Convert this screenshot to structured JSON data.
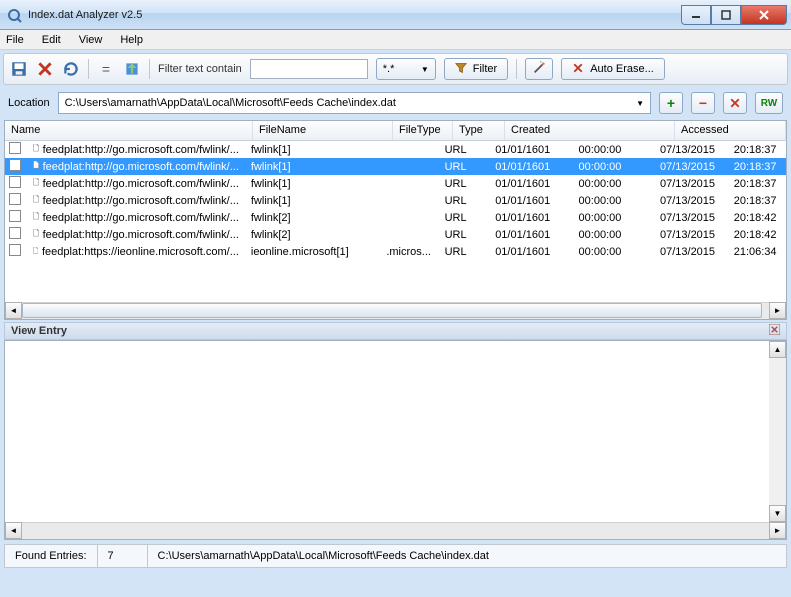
{
  "window": {
    "title": "Index.dat Analyzer v2.5"
  },
  "menu": {
    "file": "File",
    "edit": "Edit",
    "view": "View",
    "help": "Help"
  },
  "toolbar": {
    "filter_label": "Filter text contain",
    "filter_value": "",
    "wildcard": "*.*",
    "filter_btn": "Filter",
    "auto_erase": "Auto Erase..."
  },
  "location": {
    "label": "Location",
    "path": "C:\\Users\\amarnath\\AppData\\Local\\Microsoft\\Feeds Cache\\index.dat",
    "rw": "RW"
  },
  "columns": {
    "name": "Name",
    "filename": "FileName",
    "filetype": "FileType",
    "type": "Type",
    "created": "Created",
    "accessed": "Accessed"
  },
  "rows": [
    {
      "name": "feedplat:http://go.microsoft.com/fwlink/...",
      "filename": "fwlink[1]",
      "filetype": "",
      "type": "URL",
      "created_d": "01/01/1601",
      "created_t": "00:00:00",
      "accessed_d": "07/13/2015",
      "accessed_t": "20:18:37",
      "selected": false
    },
    {
      "name": "feedplat:http://go.microsoft.com/fwlink/...",
      "filename": "fwlink[1]",
      "filetype": "",
      "type": "URL",
      "created_d": "01/01/1601",
      "created_t": "00:00:00",
      "accessed_d": "07/13/2015",
      "accessed_t": "20:18:37",
      "selected": true
    },
    {
      "name": "feedplat:http://go.microsoft.com/fwlink/...",
      "filename": "fwlink[1]",
      "filetype": "",
      "type": "URL",
      "created_d": "01/01/1601",
      "created_t": "00:00:00",
      "accessed_d": "07/13/2015",
      "accessed_t": "20:18:37",
      "selected": false
    },
    {
      "name": "feedplat:http://go.microsoft.com/fwlink/...",
      "filename": "fwlink[1]",
      "filetype": "",
      "type": "URL",
      "created_d": "01/01/1601",
      "created_t": "00:00:00",
      "accessed_d": "07/13/2015",
      "accessed_t": "20:18:37",
      "selected": false
    },
    {
      "name": "feedplat:http://go.microsoft.com/fwlink/...",
      "filename": "fwlink[2]",
      "filetype": "",
      "type": "URL",
      "created_d": "01/01/1601",
      "created_t": "00:00:00",
      "accessed_d": "07/13/2015",
      "accessed_t": "20:18:42",
      "selected": false
    },
    {
      "name": "feedplat:http://go.microsoft.com/fwlink/...",
      "filename": "fwlink[2]",
      "filetype": "",
      "type": "URL",
      "created_d": "01/01/1601",
      "created_t": "00:00:00",
      "accessed_d": "07/13/2015",
      "accessed_t": "20:18:42",
      "selected": false
    },
    {
      "name": "feedplat:https://ieonline.microsoft.com/...",
      "filename": "ieonline.microsoft[1]",
      "filetype": ".micros...",
      "type": "URL",
      "created_d": "01/01/1601",
      "created_t": "00:00:00",
      "accessed_d": "07/13/2015",
      "accessed_t": "21:06:34",
      "selected": false
    }
  ],
  "view_entry": {
    "label": "View Entry"
  },
  "status": {
    "found_label": "Found Entries:",
    "count": "7",
    "path": "C:\\Users\\amarnath\\AppData\\Local\\Microsoft\\Feeds Cache\\index.dat"
  }
}
